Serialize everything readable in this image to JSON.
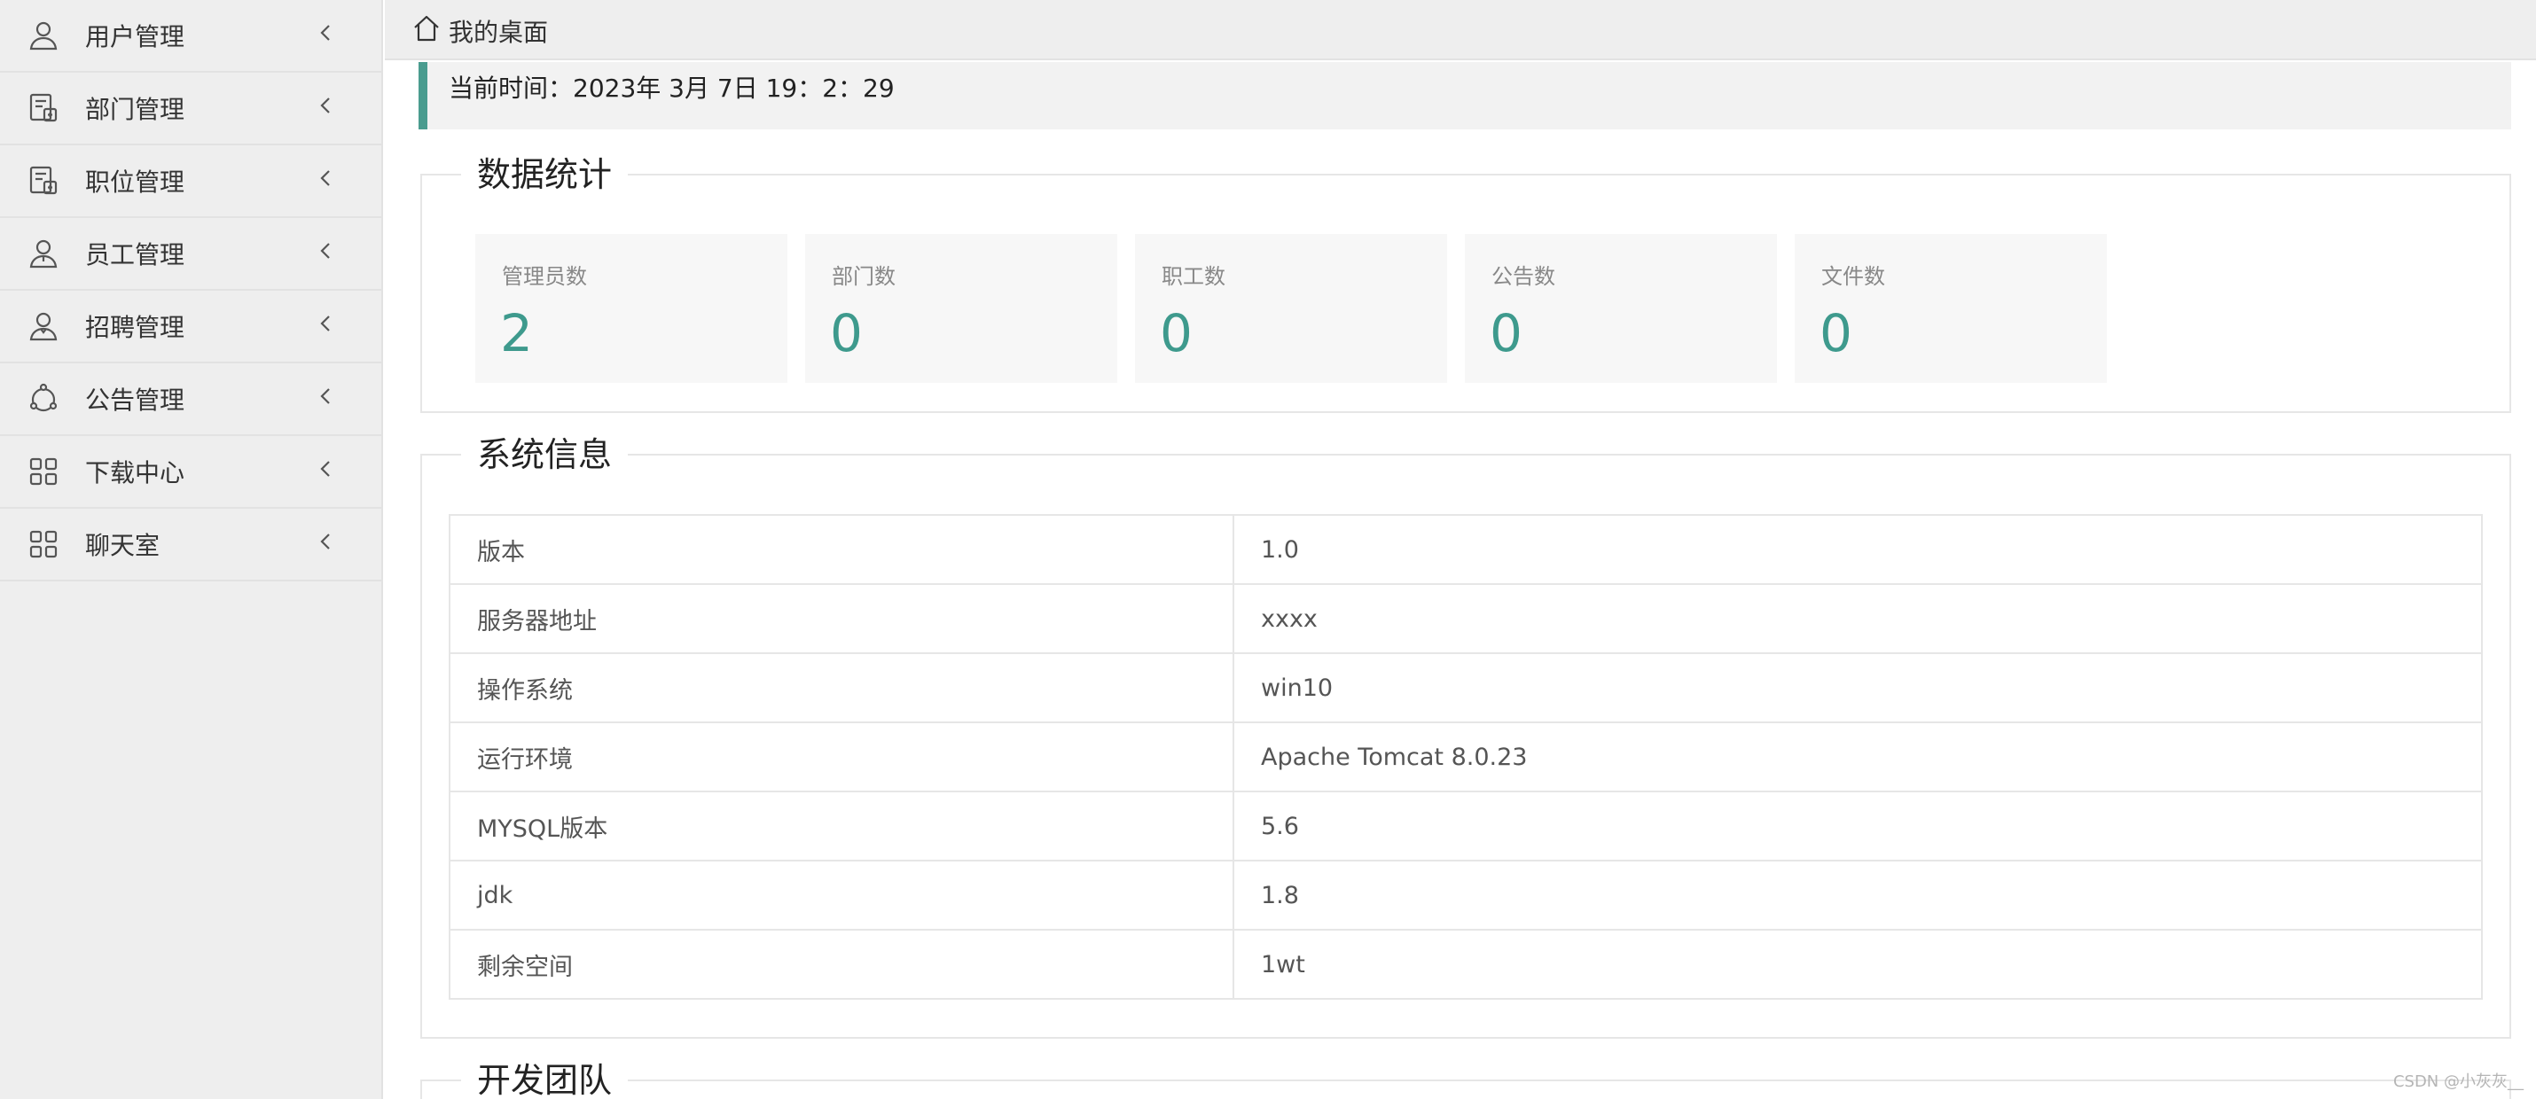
{
  "sidebar": {
    "items": [
      {
        "label": "用户管理",
        "icon": "user-icon"
      },
      {
        "label": "部门管理",
        "icon": "department-icon"
      },
      {
        "label": "职位管理",
        "icon": "position-icon"
      },
      {
        "label": "员工管理",
        "icon": "employee-icon"
      },
      {
        "label": "招聘管理",
        "icon": "recruit-icon"
      },
      {
        "label": "公告管理",
        "icon": "notice-icon"
      },
      {
        "label": "下载中心",
        "icon": "grid-icon"
      },
      {
        "label": "聊天室",
        "icon": "grid-icon"
      }
    ]
  },
  "header": {
    "title": "我的桌面",
    "icon": "home-icon"
  },
  "time_banner": {
    "text": "当前时间：2023年 3月 7日 19：2：29"
  },
  "stats": {
    "title": "数据统计",
    "cards": [
      {
        "label": "管理员数",
        "value": "2"
      },
      {
        "label": "部门数",
        "value": "0"
      },
      {
        "label": "职工数",
        "value": "0"
      },
      {
        "label": "公告数",
        "value": "0"
      },
      {
        "label": "文件数",
        "value": "0"
      }
    ]
  },
  "system_info": {
    "title": "系统信息",
    "rows": [
      {
        "key": "版本",
        "value": "1.0"
      },
      {
        "key": "服务器地址",
        "value": "xxxx"
      },
      {
        "key": "操作系统",
        "value": "win10"
      },
      {
        "key": "运行环境",
        "value": "Apache Tomcat 8.0.23"
      },
      {
        "key": "MYSQL版本",
        "value": "5.6"
      },
      {
        "key": "jdk",
        "value": "1.8"
      },
      {
        "key": "剩余空间",
        "value": "1wt"
      }
    ]
  },
  "dev_team": {
    "title": "开发团队"
  },
  "watermark": "CSDN @小灰灰__",
  "colors": {
    "accent": "#3e9a8d",
    "sidebar_bg": "#eeeeee"
  }
}
